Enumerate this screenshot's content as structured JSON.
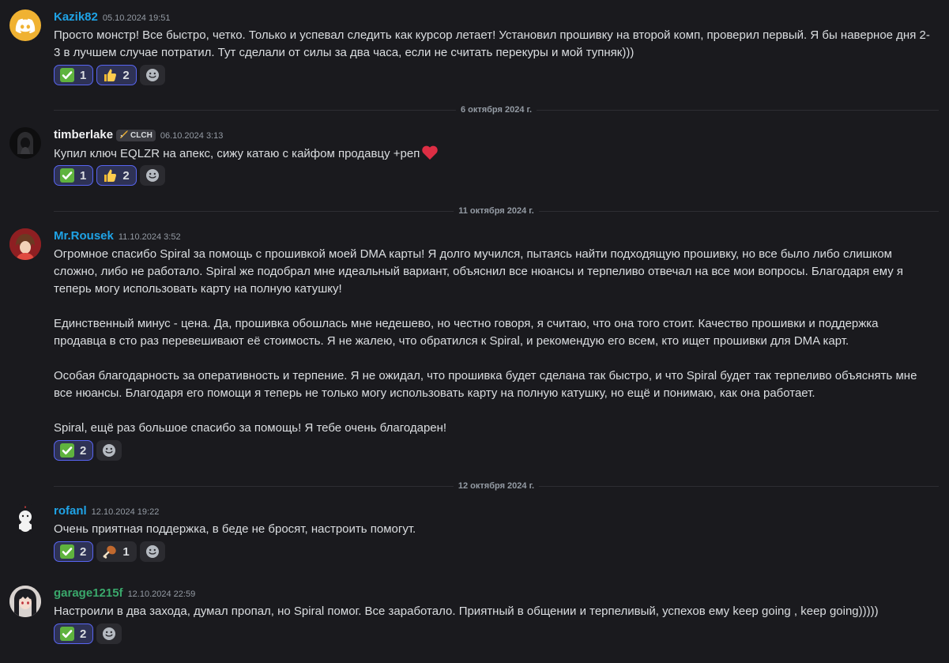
{
  "colors": {
    "background": "#1a1a1e",
    "blurple": "#5865f2",
    "username_blue": "#1fa3e6",
    "username_white": "#f2f3f5",
    "username_green": "#3aa86b"
  },
  "messages": [
    {
      "username": "Kazik82",
      "timestamp": "05.10.2024 19:51",
      "body": [
        "Просто монстр! Все быстро, четко. Только и успевал следить как курсор летает! Установил прошивку на второй комп, проверил первый. Я бы наверное дня 2-3 в лучшем случае потратил. Тут сделали от силы за два часа, если не считать перекуры и мой тупняк)))"
      ],
      "reactions": [
        {
          "emoji": "check-mark-icon",
          "count": "1"
        },
        {
          "emoji": "thumbs-up-icon",
          "count": "2"
        }
      ]
    },
    {
      "username": "timberlake",
      "tag": "CLCH",
      "timestamp": "06.10.2024 3:13",
      "body": [
        "Купил ключ EQLZR на апекс, сижу катаю с кайфом продавцу +реп"
      ],
      "reactions": [
        {
          "emoji": "check-mark-icon",
          "count": "1"
        },
        {
          "emoji": "thumbs-up-icon",
          "count": "2"
        }
      ]
    },
    {
      "username": "Mr.Rousek",
      "timestamp": "11.10.2024 3:52",
      "body": [
        "Огромное спасибо Spiral за помощь с прошивкой моей DMA карты! Я долго мучился, пытаясь найти подходящую прошивку, но все было либо слишком сложно, либо не работало. Spiral же подобрал мне идеальный вариант, объяснил все нюансы и терпеливо отвечал на все мои вопросы. Благодаря ему я теперь могу использовать карту на полную катушку!",
        "Единственный минус - цена. Да, прошивка обошлась мне недешево, но честно говоря, я считаю, что она того стоит. Качество прошивки и поддержка продавца в сто раз перевешивают её стоимость. Я не жалею, что обратился к Spiral, и рекомендую его всем, кто ищет прошивки для DMA карт.",
        "Особая благодарность за оперативность и терпение. Я не ожидал, что прошивка будет сделана так быстро, и что Spiral будет так терпеливо объяснять мне все нюансы. Благодаря его помощи я теперь не только могу использовать карту на полную катушку, но ещё и понимаю, как она работает.",
        "Spiral, ещё раз большое спасибо за помощь! Я тебе очень благодарен!"
      ],
      "reactions": [
        {
          "emoji": "check-mark-icon",
          "count": "2"
        }
      ]
    },
    {
      "username": "rofanl",
      "timestamp": "12.10.2024 19:22",
      "body": [
        "Очень приятная поддержка, в беде не бросят, настроить помогут."
      ],
      "reactions": [
        {
          "emoji": "check-mark-icon",
          "count": "2"
        },
        {
          "emoji": "poultry-leg-icon",
          "count": "1"
        }
      ]
    },
    {
      "username": "garage1215f",
      "timestamp": "12.10.2024 22:59",
      "body": [
        "Настроили в два захода, думал пропал, но Spiral помог. Все заработало. Приятный в общении и терпеливый, успехов ему keep going , keep going)))))"
      ],
      "reactions": [
        {
          "emoji": "check-mark-icon",
          "count": "2"
        }
      ]
    }
  ],
  "dividers": [
    {
      "label": "6 октября 2024 г."
    },
    {
      "label": "11 октября 2024 г."
    },
    {
      "label": "12 октября 2024 г."
    }
  ]
}
